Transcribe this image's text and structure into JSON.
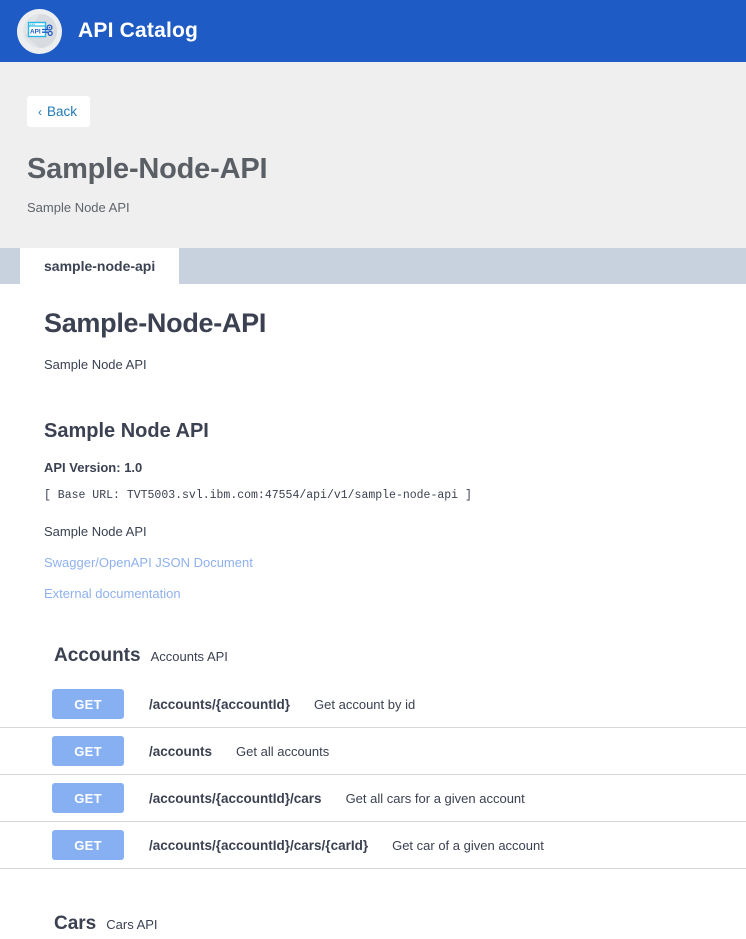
{
  "appbar": {
    "logo_icon": "api-gear-window-icon",
    "title": "API Catalog"
  },
  "page_header": {
    "back_label": "Back",
    "back_icon": "chevron-left-icon",
    "title": "Sample-Node-API",
    "subtitle": "Sample Node API"
  },
  "tabs": [
    {
      "label": "sample-node-api",
      "active": true
    }
  ],
  "swagger": {
    "title": "Sample-Node-API",
    "subtitle": "Sample Node API",
    "info": {
      "title": "Sample Node API",
      "version_label": "API Version: 1.0",
      "base_url": "[ Base URL: TVT5003.svl.ibm.com:47554/api/v1/sample-node-api ]",
      "description": "Sample Node API",
      "json_link": "Swagger/OpenAPI JSON Document",
      "external_docs_link": "External documentation"
    },
    "tags": [
      {
        "name": "Accounts",
        "description": "Accounts API",
        "operations": [
          {
            "method": "GET",
            "path": "/accounts/{accountId}",
            "summary": "Get account by id"
          },
          {
            "method": "GET",
            "path": "/accounts",
            "summary": "Get all accounts"
          },
          {
            "method": "GET",
            "path": "/accounts/{accountId}/cars",
            "summary": "Get all cars for a given account"
          },
          {
            "method": "GET",
            "path": "/accounts/{accountId}/cars/{carId}",
            "summary": "Get car of a given account"
          }
        ]
      },
      {
        "name": "Cars",
        "description": "Cars API",
        "operations": []
      }
    ]
  },
  "colors": {
    "appbar_blue": "#1f5bc4",
    "header_band_gray": "#efefef",
    "tabstrip_gray_blue": "#c8d1de",
    "get_badge_blue": "#86b0f2",
    "link_blue": "#8fb1ee",
    "back_link_blue": "#2079b5",
    "text_dark": "#3b4151"
  }
}
